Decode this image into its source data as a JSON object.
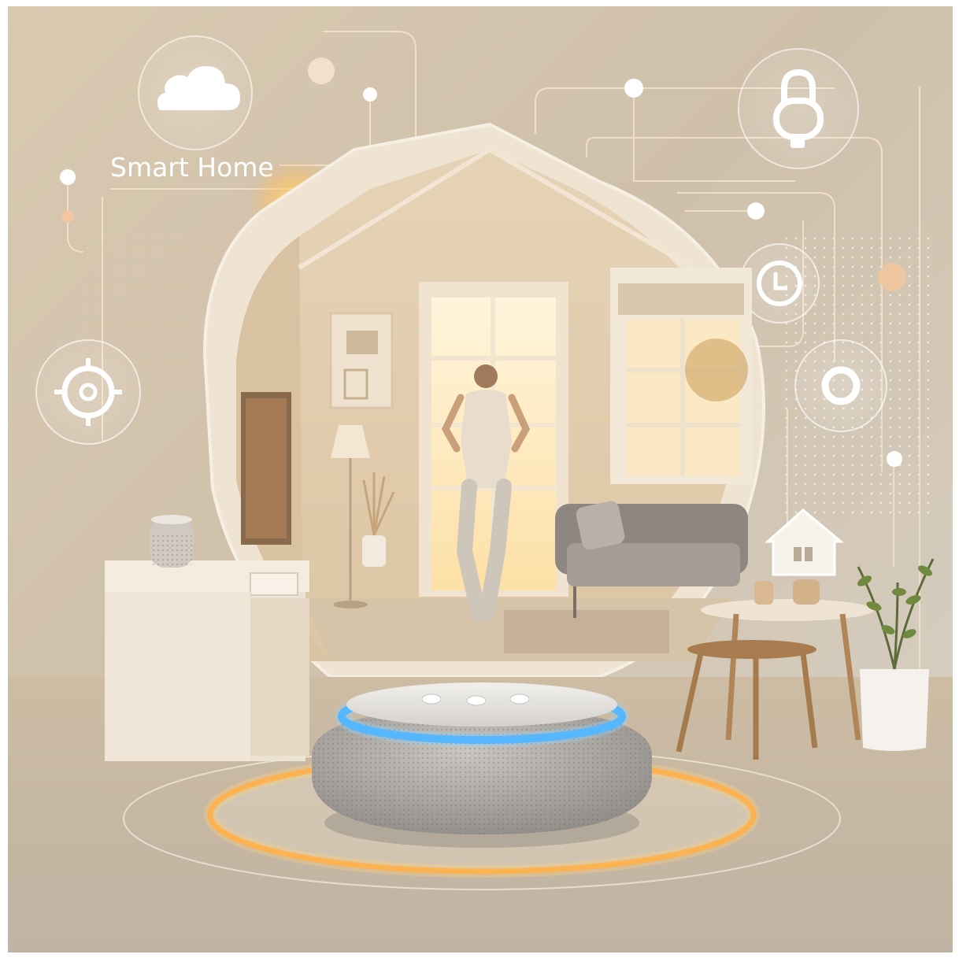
{
  "scene": {
    "headline": "Smart Home",
    "icons": [
      "cloud-icon",
      "lock-icon",
      "target-icon",
      "clock-icon",
      "ring-icon",
      "house-icon"
    ],
    "colors": {
      "background": "#cdbfa9",
      "warm_glow": "#ffb347",
      "wall": "#e9dbc4",
      "speaker_ring": "#35a8ff",
      "speaker_body": "#a9a6a2",
      "floor": "#c9bca8"
    }
  }
}
